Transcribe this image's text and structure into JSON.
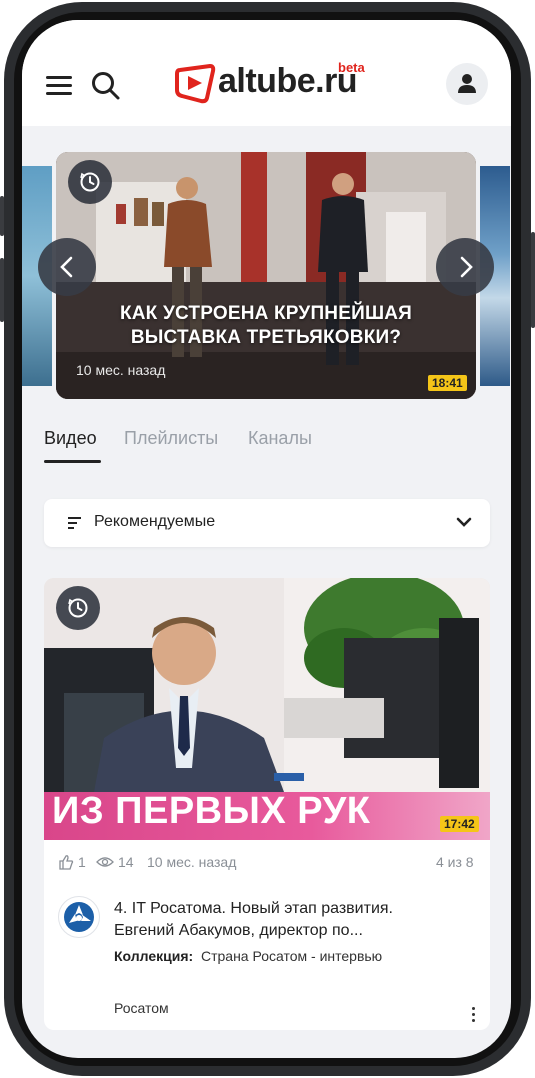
{
  "header": {
    "logo_text": "altube.ru",
    "logo_beta": "beta"
  },
  "hero": {
    "title_line1": "КАК УСТРОЕНА КРУПНЕЙШАЯ",
    "title_line2": "ВЫСТАВКА ТРЕТЬЯКОВКИ?",
    "date": "10 мес. назад",
    "duration": "18:41"
  },
  "tabs": [
    {
      "label": "Видео",
      "active": true
    },
    {
      "label": "Плейлисты",
      "active": false
    },
    {
      "label": "Каналы",
      "active": false
    }
  ],
  "sort": {
    "label": "Рекомендуемые"
  },
  "card": {
    "thumb_text": "ИЗ ПЕРВЫХ РУК",
    "duration": "17:42",
    "likes": "1",
    "views": "14",
    "date": "10 мес. назад",
    "position": "4 из 8",
    "title_line1": "4. IT Росатома. Новый этап развития.",
    "title_line2": "Евгений Абакумов, директор по...",
    "collection_label": "Коллекция:",
    "collection_value": "Страна Росатом - интервью",
    "channel": "Росатом"
  },
  "colors": {
    "accent": "#e0241d",
    "duration_badge": "#f5c518",
    "pink_banner": "#d9468a"
  }
}
